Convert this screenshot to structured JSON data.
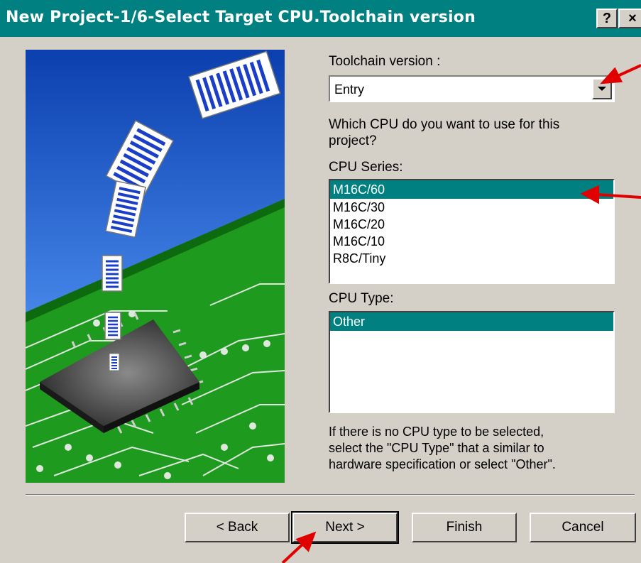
{
  "window": {
    "title": "New Project-1/6-Select Target CPU.Toolchain version",
    "help_label": "?",
    "close_label": "×"
  },
  "toolchain": {
    "label": "Toolchain version :",
    "value": "Entry"
  },
  "question": {
    "line1": "Which CPU do you want to use for this",
    "line2": "project?"
  },
  "cpu_series": {
    "label": "CPU Series:",
    "items": [
      "M16C/60",
      "M16C/30",
      "M16C/20",
      "M16C/10",
      "R8C/Tiny"
    ],
    "selected": "M16C/60"
  },
  "cpu_type": {
    "label": "CPU Type:",
    "items": [
      "Other"
    ],
    "selected": "Other"
  },
  "hint": {
    "line1": "If there is no CPU type to be selected,",
    "line2": "select the \"CPU Type\" that a similar to",
    "line3": "hardware specification or select \"Other\"."
  },
  "buttons": {
    "back": "< Back",
    "next": "Next >",
    "finish": "Finish",
    "cancel": "Cancel"
  },
  "colors": {
    "titlebar": "#008080",
    "selection": "#008080",
    "dialog_bg": "#d4d0c8",
    "annotation_arrow": "#e00000"
  }
}
